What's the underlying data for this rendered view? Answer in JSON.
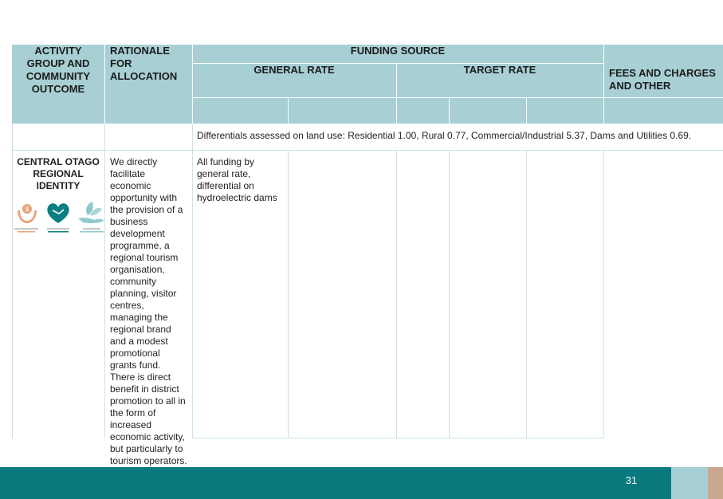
{
  "table": {
    "headers": {
      "activity": "ACTIVITY GROUP AND COMMUNITY OUTCOME",
      "rationale": "RATIONALE FOR ALLOCATION",
      "funding_source": "FUNDING SOURCE",
      "general_rate": "GENERAL RATE",
      "target_rate": "TARGET RATE",
      "fees": "FEES AND CHARGES AND OTHER"
    },
    "differentials_note": "Differentials assessed on land use: Residential 1.00, Rural 0.77, Commercial/Industrial 5.37, Dams and Utilities 0.69.",
    "rows": [
      {
        "activity": "CENTRAL OTAGO REGIONAL IDENTITY",
        "rationale": "We directly facilitate economic opportunity with the provision of a business development programme, a regional tourism organisation, community planning, visitor centres, managing the regional brand and a modest promotional grants fund. There is direct benefit in district promotion to all in the form of increased economic activity, but particularly to tourism operators.",
        "general_rate": "All funding by general rate, differential on hydroelectric dams"
      }
    ]
  },
  "outcome_icons": [
    {
      "name": "money-hands-icon",
      "color": "#e8a27a"
    },
    {
      "name": "heart-hands-icon",
      "color": "#0a7e81"
    },
    {
      "name": "leaf-hand-icon",
      "color": "#8fc9cc"
    }
  ],
  "footer": {
    "page_number": "31"
  },
  "colors": {
    "header_fill": "#a7cfd4",
    "grid_line": "#c9e3e6",
    "footer_teal": "#08797c",
    "footer_light": "#a6cfd3",
    "footer_tan": "#caa890"
  }
}
